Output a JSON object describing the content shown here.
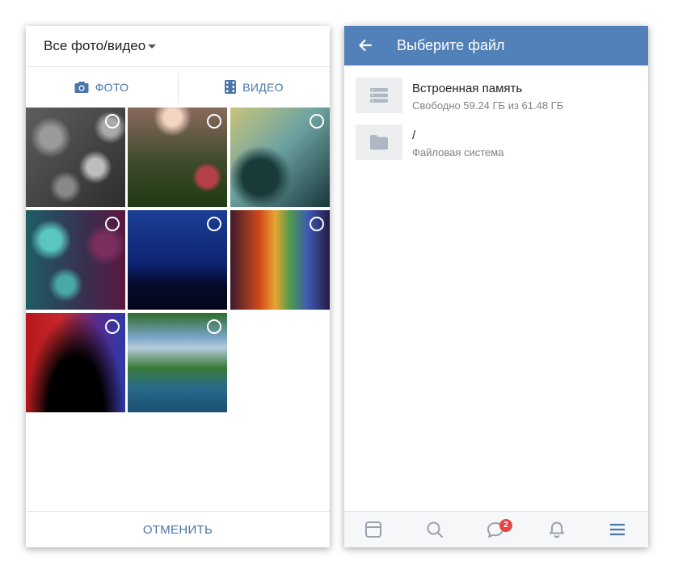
{
  "gallery": {
    "title": "Все фото/видео",
    "tabs": [
      {
        "label": "ФОТО",
        "icon": "camera-icon"
      },
      {
        "label": "ВИДЕО",
        "icon": "film-icon"
      }
    ],
    "photos": [
      {
        "name": "gray-android-bokeh",
        "selected": false
      },
      {
        "name": "mushroom-bokeh",
        "selected": false
      },
      {
        "name": "raindrops-teal",
        "selected": false
      },
      {
        "name": "teal-android-bokeh",
        "selected": false
      },
      {
        "name": "blue-grass-night",
        "selected": false
      },
      {
        "name": "aurora-stripes",
        "selected": false
      },
      {
        "name": "red-blue-rays",
        "selected": false
      },
      {
        "name": "mountain-lake",
        "selected": false
      }
    ],
    "cancel_label": "ОТМЕНИТЬ"
  },
  "file_picker": {
    "title": "Выберите файл",
    "items": [
      {
        "name": "Встроенная память",
        "subtitle": "Свободно 59.24 ГБ из 61.48 ГБ",
        "icon": "storage-icon"
      },
      {
        "name": "/",
        "subtitle": "Файловая система",
        "icon": "folder-icon"
      }
    ]
  },
  "bottom_nav": {
    "items": [
      "news-icon",
      "search-icon",
      "messages-icon",
      "notifications-icon",
      "menu-icon"
    ],
    "messages_badge": "2"
  },
  "colors": {
    "accent": "#5181b8",
    "link": "#4a76a8",
    "badge": "#e64646"
  }
}
